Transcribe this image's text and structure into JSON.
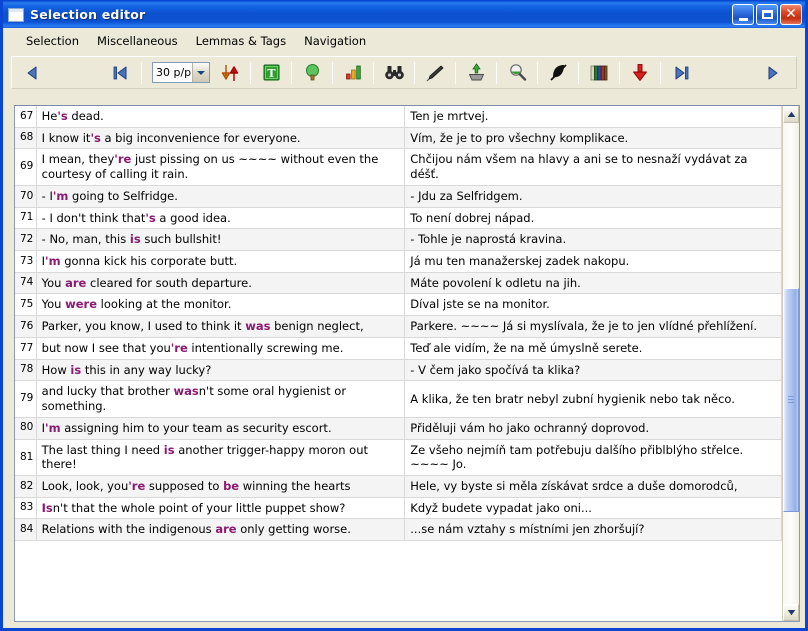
{
  "window": {
    "title": "Selection editor",
    "icon": "document-icon",
    "buttons": {
      "minimize": "Minimize",
      "maximize": "Maximize",
      "close": "Close"
    },
    "accent_color": "#0a46d2",
    "chrome_color": "#ece9d8"
  },
  "menubar": {
    "items": [
      {
        "label": "Selection",
        "name": "menu-selection"
      },
      {
        "label": "Miscellaneous",
        "name": "menu-miscellaneous"
      },
      {
        "label": "Lemmas & Tags",
        "name": "menu-lemmas-tags"
      },
      {
        "label": "Navigation",
        "name": "menu-navigation"
      }
    ]
  },
  "toolbar": {
    "prev_page": "previous-page-arrow-icon",
    "first_page": "first-page-icon",
    "page_size": {
      "value": "30 p/p",
      "name": "page-size-select"
    },
    "sort_icon": "sort-updown-arrows-icon",
    "tag_icon": "green-t-tag-icon",
    "tree_icon": "tree-icon",
    "chart_icon": "bar-chart-icon",
    "find_icon": "binoculars-icon",
    "pen_icon": "pen-icon",
    "import_icon": "import-green-arrow-icon",
    "zoom_icon": "magnifier-icon",
    "contrast_icon": "contrast-leaf-icon",
    "books_icon": "books-icon",
    "download_icon": "red-down-arrow-icon",
    "last_page": "last-page-icon",
    "next_page": "next-page-arrow-icon"
  },
  "highlight_color": "#8a1a72",
  "table": {
    "rows": [
      {
        "n": "67",
        "src": [
          [
            "He",
            0
          ],
          [
            "'s",
            1
          ],
          [
            " dead.",
            0
          ]
        ],
        "tgt": "Ten je mrtvej."
      },
      {
        "n": "68",
        "src": [
          [
            "I know it",
            0
          ],
          [
            "'s",
            1
          ],
          [
            " a big inconvenience for everyone.",
            0
          ]
        ],
        "tgt": "Vím, že je to pro všechny komplikace."
      },
      {
        "n": "69",
        "src": [
          [
            "I mean, they",
            0
          ],
          [
            "'re",
            1
          ],
          [
            " just pissing on us ~~~~ without even the courtesy of calling it rain.",
            0
          ]
        ],
        "tgt": "Chčijou nám všem na hlavy a ani se to nesnaží vydávat za déšť."
      },
      {
        "n": "70",
        "src": [
          [
            "- I",
            0
          ],
          [
            "'m",
            1
          ],
          [
            " going to Selfridge.",
            0
          ]
        ],
        "tgt": "- Jdu za Selfridgem."
      },
      {
        "n": "71",
        "src": [
          [
            "- I don't think that",
            0
          ],
          [
            "'s",
            1
          ],
          [
            " a good idea.",
            0
          ]
        ],
        "tgt": "To není dobrej nápad."
      },
      {
        "n": "72",
        "src": [
          [
            "- No, man, this ",
            0
          ],
          [
            "is",
            1
          ],
          [
            " such bullshit!",
            0
          ]
        ],
        "tgt": "- Tohle je naprostá kravina."
      },
      {
        "n": "73",
        "src": [
          [
            "I",
            0
          ],
          [
            "'m",
            1
          ],
          [
            " gonna kick his corporate butt.",
            0
          ]
        ],
        "tgt": "Já mu ten manažerskej zadek nakopu."
      },
      {
        "n": "74",
        "src": [
          [
            "You ",
            0
          ],
          [
            "are",
            1
          ],
          [
            " cleared for south departure.",
            0
          ]
        ],
        "tgt": "Máte povolení k odletu na jih."
      },
      {
        "n": "75",
        "src": [
          [
            "You ",
            0
          ],
          [
            "were",
            1
          ],
          [
            " looking at the monitor.",
            0
          ]
        ],
        "tgt": "Díval jste se na monitor."
      },
      {
        "n": "76",
        "src": [
          [
            "Parker, you know, I used to think it ",
            0
          ],
          [
            "was",
            1
          ],
          [
            " benign neglect,",
            0
          ]
        ],
        "tgt": "Parkere. ~~~~ Já si myslívala, že je to jen vlídné přehlížení."
      },
      {
        "n": "77",
        "src": [
          [
            "but now I see that you",
            0
          ],
          [
            "'re",
            1
          ],
          [
            " intentionally screwing me.",
            0
          ]
        ],
        "tgt": "Teď ale vidím, že na mě úmyslně serete."
      },
      {
        "n": "78",
        "src": [
          [
            "How ",
            0
          ],
          [
            "is",
            1
          ],
          [
            " this in any way lucky?",
            0
          ]
        ],
        "tgt": "- V čem jako spočívá ta klika?"
      },
      {
        "n": "79",
        "src": [
          [
            "and lucky that brother ",
            0
          ],
          [
            "was",
            1
          ],
          [
            "n't some oral hygienist or something.",
            0
          ]
        ],
        "tgt": "A klika, že ten bratr nebyl zubní hygienik nebo tak něco."
      },
      {
        "n": "80",
        "src": [
          [
            "I",
            0
          ],
          [
            "'m",
            1
          ],
          [
            " assigning him to your team as security escort.",
            0
          ]
        ],
        "tgt": "Přiděluji vám ho jako ochranný doprovod."
      },
      {
        "n": "81",
        "src": [
          [
            "The last thing I need ",
            0
          ],
          [
            "is",
            1
          ],
          [
            " another trigger-happy moron out there!",
            0
          ]
        ],
        "tgt": "Ze všeho nejmíň tam potřebuju dalšího přiblblýho střelce. ~~~~ Jo."
      },
      {
        "n": "82",
        "src": [
          [
            "Look, look, you",
            0
          ],
          [
            "'re",
            1
          ],
          [
            " supposed to ",
            0
          ],
          [
            "be",
            1
          ],
          [
            " winning the hearts",
            0
          ]
        ],
        "tgt": "Hele, vy byste si měla získávat srdce a duše domorodců,"
      },
      {
        "n": "83",
        "src": [
          [
            "Is",
            1
          ],
          [
            "n't that the whole point of your little puppet show?",
            0
          ]
        ],
        "tgt": "Když budete vypadat jako oni..."
      },
      {
        "n": "84",
        "src": [
          [
            "Relations with the indigenous ",
            0
          ],
          [
            "are",
            1
          ],
          [
            " only getting worse.",
            0
          ]
        ],
        "tgt": "...se nám vztahy s místními jen zhoršují?"
      }
    ]
  },
  "scrollbar": {
    "up_arrow": "scroll-up-arrow-icon",
    "down_arrow": "scroll-down-arrow-icon",
    "thumb": "scroll-thumb"
  }
}
